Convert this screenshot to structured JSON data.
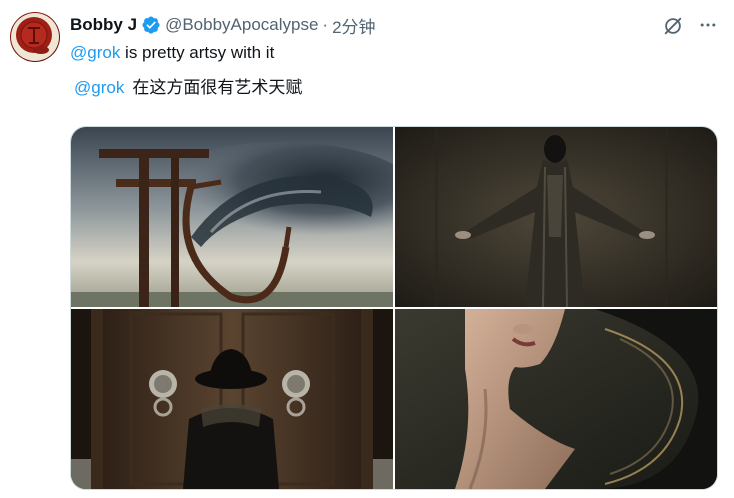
{
  "tweet": {
    "author": {
      "display_name": "Bobby J",
      "handle": "@BobbyApocalypse",
      "verified": true,
      "avatar_icon": "wax-seal-avatar"
    },
    "separator": "·",
    "timestamp": "2分钟",
    "text_mention": "@grok",
    "text_body": " is pretty artsy with it",
    "translation": {
      "mention": "@grok",
      "body": "在这方面很有艺术天赋"
    },
    "icons": {
      "grok": "grok-icon",
      "more": "more-options-icon"
    },
    "media": [
      {
        "name": "torii-gate-storm-image"
      },
      {
        "name": "robed-figure-image"
      },
      {
        "name": "hat-figure-lion-door-image"
      },
      {
        "name": "face-swirl-portrait-image"
      }
    ]
  },
  "colors": {
    "accent": "#1d9bf0",
    "text": "#0f1419",
    "secondary": "#536471",
    "border": "#cfd9de"
  }
}
